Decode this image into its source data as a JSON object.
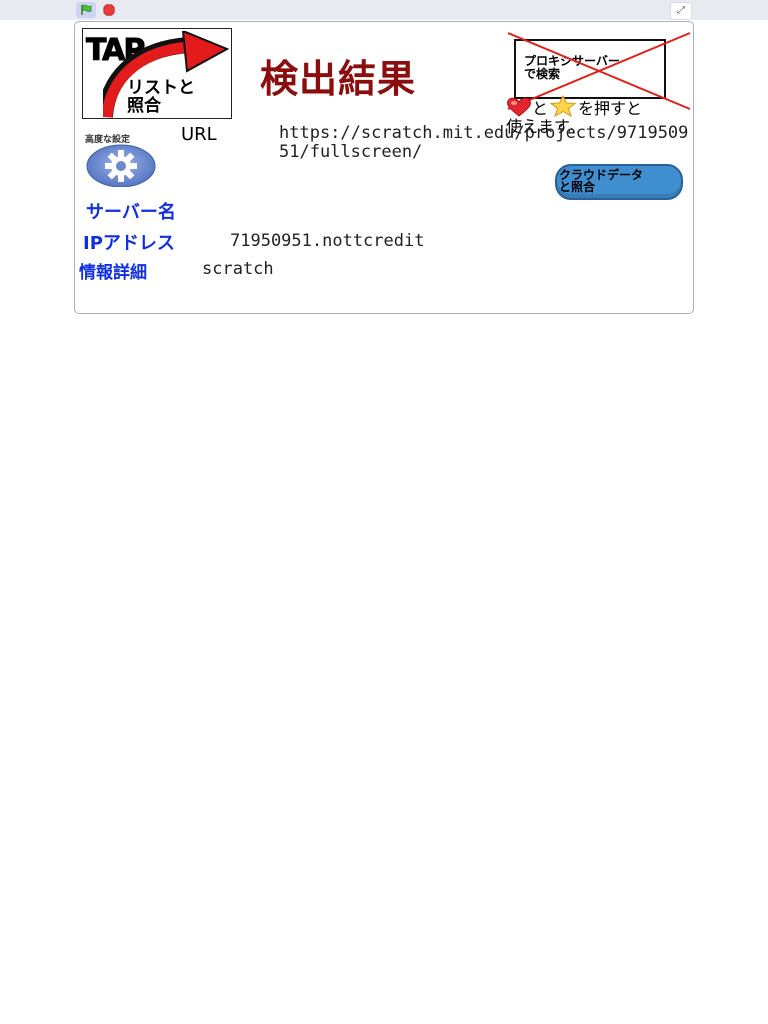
{
  "toolbar": {
    "green_flag_icon": "green-flag-icon",
    "stop_icon": "stop-icon",
    "fullscreen_icon": "exit-fullscreen-icon",
    "fullscreen_symbol": "⤢"
  },
  "stage": {
    "tap_button": {
      "tap_text": "TAP",
      "label_line1": "リストと",
      "label_line2": "照合"
    },
    "title": "検出結果",
    "proxy_button": {
      "label": "プロキシサーバー\nで検索"
    },
    "fav_hint": {
      "after_heart": "と",
      "after_star": "を押すと",
      "line2": "使えます。"
    },
    "advanced": {
      "label": "高度な設定"
    },
    "url": {
      "label": "URL",
      "value": "https://scratch.mit.edu/projects/971950951/fullscreen/"
    },
    "cloud_button": {
      "label_line1": "クラウドデータ",
      "label_line2": "と照合"
    },
    "fields": {
      "server_name_label": "サーバー名",
      "server_name_value": "",
      "ip_label": "IPアドレス",
      "ip_value": "71950951.nottcredit",
      "detail_label": "情報詳細",
      "detail_value": "scratch"
    }
  },
  "colors": {
    "title": "#8b0d0d",
    "field_label": "#1030e0",
    "cloud_button": "#3f8fd0",
    "cross": "#e0201a",
    "tap_arrow": "#e31b1b"
  }
}
